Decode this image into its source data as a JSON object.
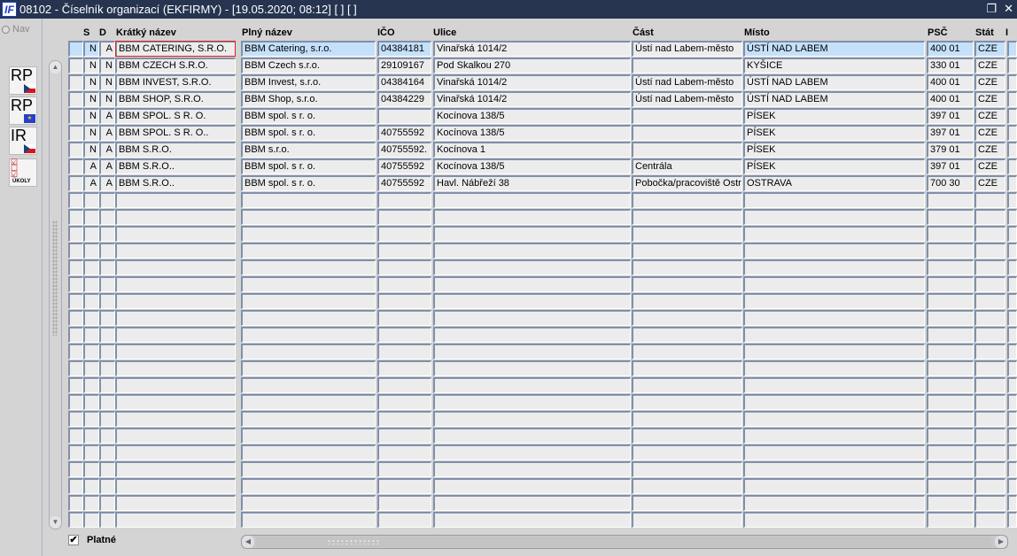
{
  "window": {
    "title": "08102 - Číselník organizací (EKFIRMY) - [19.05.2020; 08:12]  [ ]  [ ]",
    "app_icon": "IF",
    "restore_icon": "restore-icon",
    "close_icon": "close-icon"
  },
  "left_panel": {
    "nav_label": "Nav",
    "buttons": [
      {
        "label": "RP",
        "icon": "cz-flag"
      },
      {
        "label": "RP",
        "icon": "eu-flag"
      },
      {
        "label": "IR",
        "icon": "cz-flag"
      },
      {
        "label": "ÚKOLY",
        "icon": "task-list"
      }
    ]
  },
  "table": {
    "columns": [
      "S",
      "D",
      "Krátký název",
      "Plný název",
      "IČO",
      "Ulice",
      "Část",
      "Místo",
      "PSČ",
      "Stát",
      "I"
    ],
    "rows": [
      {
        "s": "N",
        "d": "A",
        "short": "BBM CATERING, S.R.O.",
        "full": "BBM Catering, s.r.o.",
        "ico": "04384181",
        "street": "Vinařská 1014/2",
        "part": "Ústí nad Labem-město",
        "city": "ÚSTÍ NAD LABEM",
        "psc": "400 01",
        "state": "CZE"
      },
      {
        "s": "N",
        "d": "N",
        "short": "BBM CZECH S.R.O.",
        "full": "BBM Czech s.r.o.",
        "ico": "29109167",
        "street": "Pod Skalkou 270",
        "part": "",
        "city": "KYŠICE",
        "psc": "330 01",
        "state": "CZE"
      },
      {
        "s": "N",
        "d": "N",
        "short": "BBM INVEST, S.R.O.",
        "full": "BBM Invest, s.r.o.",
        "ico": "04384164",
        "street": "Vinařská 1014/2",
        "part": "Ústí nad Labem-město",
        "city": "ÚSTÍ NAD LABEM",
        "psc": "400 01",
        "state": "CZE"
      },
      {
        "s": "N",
        "d": "N",
        "short": "BBM SHOP, S.R.O.",
        "full": "BBM Shop, s.r.o.",
        "ico": "04384229",
        "street": "Vinařská 1014/2",
        "part": "Ústí nad Labem-město",
        "city": "ÚSTÍ NAD LABEM",
        "psc": "400 01",
        "state": "CZE"
      },
      {
        "s": "N",
        "d": "A",
        "short": "BBM SPOL. S R. O.",
        "full": "BBM spol. s r. o.",
        "ico": "",
        "street": "Kocínova 138/5",
        "part": "",
        "city": "PÍSEK",
        "psc": "397 01",
        "state": "CZE"
      },
      {
        "s": "N",
        "d": "A",
        "short": "BBM SPOL. S R. O..",
        "full": "BBM spol. s r. o.",
        "ico": "40755592",
        "street": "Kocínova 138/5",
        "part": "",
        "city": "PÍSEK",
        "psc": "397 01",
        "state": "CZE"
      },
      {
        "s": "N",
        "d": "A",
        "short": "BBM S.R.O.",
        "full": "BBM s.r.o.",
        "ico": "40755592.",
        "street": "Kocínova 1",
        "part": "",
        "city": "PÍSEK",
        "psc": "379 01",
        "state": "CZE"
      },
      {
        "s": "A",
        "d": "A",
        "short": "BBM S.R.O..",
        "full": "BBM spol. s r. o.",
        "ico": "40755592",
        "street": "Kocínova 138/5",
        "part": "Centrála",
        "city": "PÍSEK",
        "psc": "397 01",
        "state": "CZE"
      },
      {
        "s": "A",
        "d": "A",
        "short": "BBM S.R.O..",
        "full": "BBM spol. s r. o.",
        "ico": "40755592",
        "street": "Havl. Nábřeží 38",
        "part": "Pobočka/pracoviště Ostrava",
        "city": "OSTRAVA",
        "psc": "700 30",
        "state": "CZE"
      }
    ]
  },
  "footer": {
    "platne_label": "Platné",
    "platne_checked": true
  }
}
